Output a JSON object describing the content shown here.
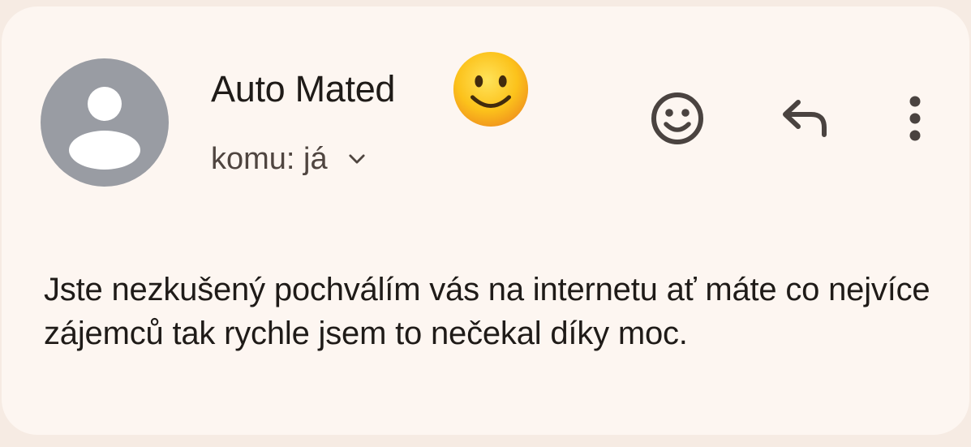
{
  "message": {
    "sender_name": "Auto Mated",
    "recipient_label": "komu: já",
    "body": "Jste nezkušený pochválím vás na internetu ať máte co nejvíce zájemců tak rychle jsem to nečekal díky moc."
  },
  "icons": {
    "avatar": "default-person-avatar",
    "sender_emoji": "slightly-smiling-face-emoji",
    "recipient_toggle": "chevron-down-icon",
    "react": "add-reaction-smiley-icon",
    "reply": "reply-arrow-icon",
    "more": "more-vert-icon"
  },
  "colors": {
    "background": "#f6ebe3",
    "card": "#fdf6f1",
    "avatar_bg": "#999ca3",
    "text_primary": "#1f1b18",
    "text_secondary": "#4f4540",
    "icon": "#4a4340"
  }
}
